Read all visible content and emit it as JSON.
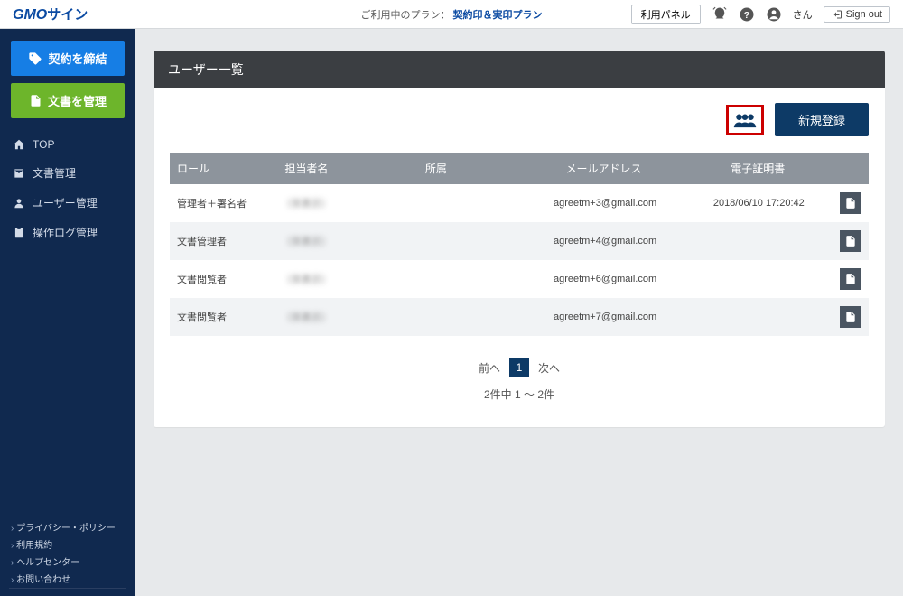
{
  "header": {
    "logo_prefix": "GMO",
    "logo_suffix": "サイン",
    "plan_prefix": "ご利用中のプラン：",
    "plan_name": "契約印＆実印プラン",
    "panel_button": "利用パネル",
    "username": "さん",
    "signout": "Sign out"
  },
  "sidebar": {
    "primary_button": "契約を締結",
    "secondary_button": "文書を管理",
    "nav": [
      "TOP",
      "文書管理",
      "ユーザー管理",
      "操作ログ管理"
    ],
    "footer": [
      "プライバシー・ポリシー",
      "利用規約",
      "ヘルプセンター",
      "お問い合わせ"
    ]
  },
  "page": {
    "title": "ユーザー一覧",
    "new_button": "新規登録"
  },
  "table": {
    "columns": {
      "role": "ロール",
      "name": "担当者名",
      "org": "所属",
      "mail": "メールアドレス",
      "cert": "電子証明書"
    },
    "rows": [
      {
        "role": "管理者＋署名者",
        "name": "（非表示）",
        "org": "",
        "mail": "agreetm+3@gmail.com",
        "cert": "2018/06/10 17:20:42"
      },
      {
        "role": "文書管理者",
        "name": "（非表示）",
        "org": "",
        "mail": "agreetm+4@gmail.com",
        "cert": ""
      },
      {
        "role": "文書閲覧者",
        "name": "（非表示）",
        "org": "",
        "mail": "agreetm+6@gmail.com",
        "cert": ""
      },
      {
        "role": "文書閲覧者",
        "name": "（非表示）",
        "org": "",
        "mail": "agreetm+7@gmail.com",
        "cert": ""
      }
    ]
  },
  "pager": {
    "prev": "前へ",
    "current": "1",
    "next": "次へ",
    "info": "2件中 1 〜 2件"
  }
}
